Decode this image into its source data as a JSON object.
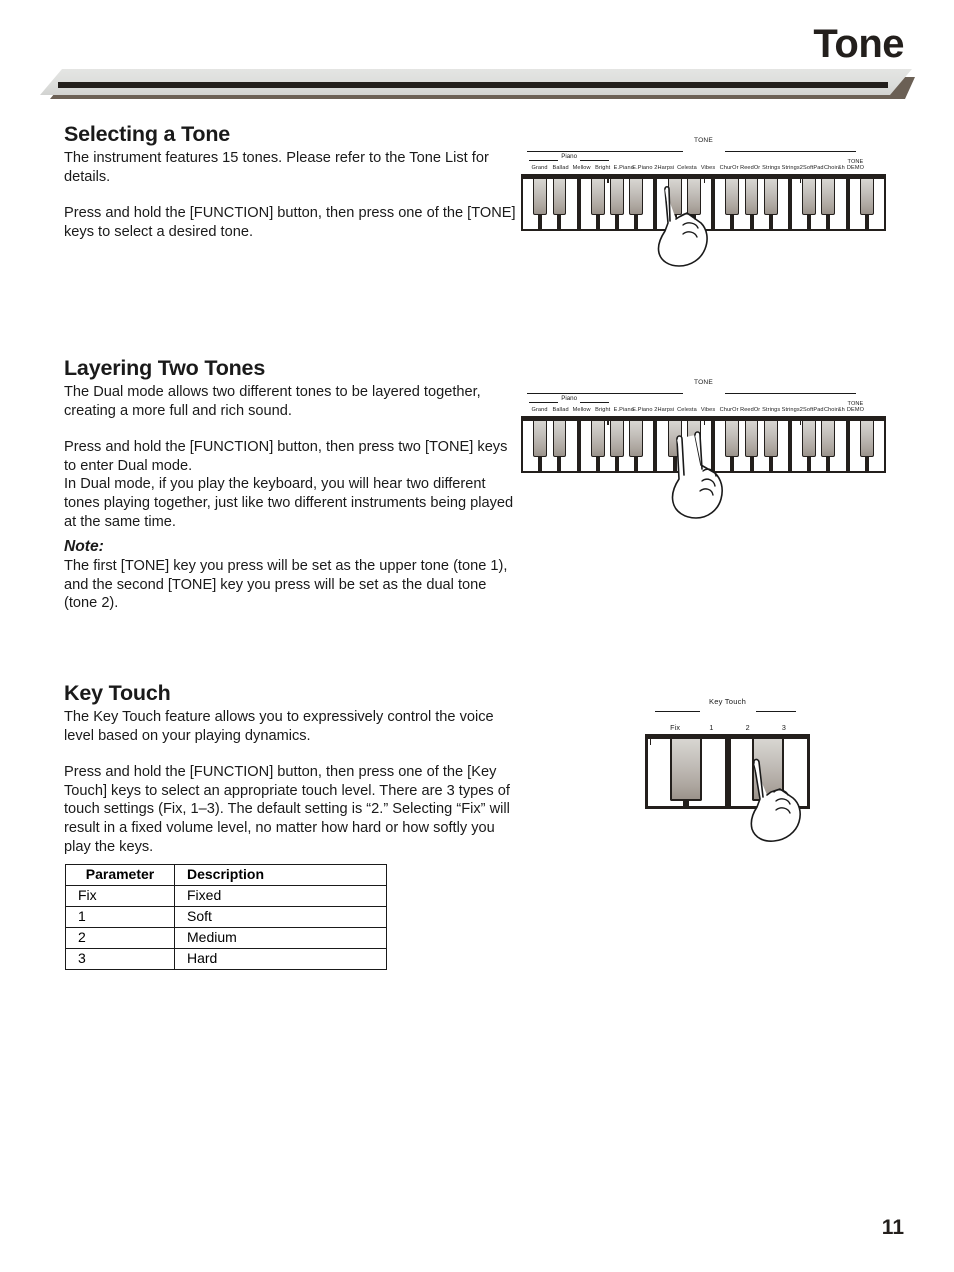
{
  "header": {
    "title": "Tone"
  },
  "sections": {
    "selecting": {
      "heading": "Selecting a Tone",
      "para1": "The instrument features 15 tones. Please refer to the Tone List for details.",
      "para2": "Press and hold the [FUNCTION] button, then press one of the [TONE] keys to select a desired tone."
    },
    "layering": {
      "heading": "Layering Two Tones",
      "para1": "The Dual mode allows two different tones to be layered together, creating a more full and rich sound.",
      "para2": "Press and hold the [FUNCTION] button, then press two [TONE] keys to enter Dual mode.\nIn Dual mode, if you play the keyboard, you will hear two different tones playing together, just like two different instruments being played at the same time."
    },
    "note": {
      "title": "Note:",
      "body": "The first [TONE] key you press will be set as the upper tone (tone 1), and the second [TONE] key you press will be set as the dual tone (tone 2)."
    },
    "keytouch": {
      "heading": "Key Touch",
      "para1": "The Key Touch feature allows you to expressively control the voice level based on your playing dynamics.",
      "para2": "Press and hold the [FUNCTION] button, then press one of the [Key Touch] keys to select an appropriate touch level. There are 3 types of touch settings (Fix, 1–3). The default setting is “2.” Selecting “Fix” will result in a fixed volume level, no matter how hard or how softly you play the keys."
    }
  },
  "table": {
    "headers": [
      "Parameter",
      "Description"
    ],
    "rows": [
      [
        "Fix",
        "Fixed"
      ],
      [
        "1",
        "Soft"
      ],
      [
        "2",
        "Medium"
      ],
      [
        "3",
        "Hard"
      ]
    ]
  },
  "tone_panel": {
    "bracket_title": "TONE",
    "sub_bracket_title": "Piano",
    "keys": [
      "Grand",
      "Ballad",
      "Mellow",
      "Bright",
      "E.Piano",
      "E.Piano 2",
      "Harpsi",
      "Celesta",
      "Vibes",
      "ChurOr",
      "ReedOr",
      "Strings",
      "Strings2",
      "SoftPad",
      "Choir&h"
    ],
    "demo_label_line1": "TONE",
    "demo_label_line2": "DEMO"
  },
  "keytouch_panel": {
    "bracket_title": "Key Touch",
    "keys": [
      "Fix",
      "1",
      "2",
      "3"
    ]
  },
  "figures": {
    "tone_select_hand": "hand-one-finger-icon",
    "tone_layer_hand": "hand-two-finger-icon",
    "keytouch_hand": "hand-one-finger-icon"
  },
  "footer": {
    "page_number": "11"
  },
  "colors": {
    "ink": "#1a1a1a",
    "ribbon_body": "#dcdddb",
    "ribbon_shadow": "#6b6055",
    "key_black_top": "#d8d6d2",
    "key_black_bottom": "#9b938b"
  }
}
